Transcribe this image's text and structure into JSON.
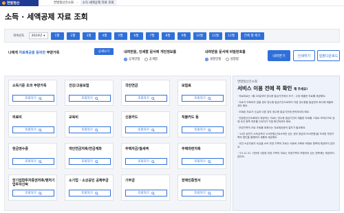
{
  "topbar": {
    "logo": "연말정산",
    "crumbs": [
      "연말정산간소화",
      "소득·세액공제 자료 조회"
    ]
  },
  "page_title": "소득 · 세액공제 자료 조회",
  "year_filter": {
    "label": "귀속년도",
    "selected_year": "2024년",
    "months": [
      "1월",
      "2월",
      "3월",
      "4월",
      "5월",
      "6월",
      "7월",
      "8월",
      "9월",
      "10월",
      "11월",
      "12월"
    ],
    "all_label": "전체 월 체크"
  },
  "filter": {
    "consent_pre": "나에게 ",
    "consent_hl": "자료제공을 동의한",
    "consent_post": " 부양가족",
    "detail_button": "상세보기",
    "privacy": {
      "label": "내려받을, 인쇄할 문서에 개인정보를",
      "options": [
        "공개안함",
        "공개함"
      ],
      "selected": 0
    },
    "password": {
      "label": "내려받을 문서에 비밀번호를",
      "options": [
        "설정안함",
        "설정함"
      ],
      "selected": 0
    }
  },
  "actions": {
    "download": "내려받기",
    "print": "인쇄하기",
    "simplified": "일괄다운로드"
  },
  "cards": [
    {
      "title": "소득기준 초과 부양가족",
      "button": "조회하기"
    },
    {
      "title": "건강/고용보험",
      "button": "조회하기"
    },
    {
      "title": "국민연금",
      "button": "조회하기"
    },
    {
      "title": "보험료",
      "button": "조회하기"
    },
    {
      "title": "의료비",
      "button": "조회하기"
    },
    {
      "title": "교육비",
      "button": "조회하기"
    },
    {
      "title": "신용카드",
      "button": "조회하기"
    },
    {
      "title": "직불카드 등",
      "button": "조회하기"
    },
    {
      "title": "현금영수증",
      "button": "조회하기"
    },
    {
      "title": "개인연금저축/연금계좌",
      "button": "조회하기"
    },
    {
      "title": "주택자금/월세액",
      "button": "조회하기"
    },
    {
      "title": "주택마련저축",
      "button": "조회하기"
    },
    {
      "title": "장기집합투자증권저축/벤처기업투자신탁",
      "button": "조회하기"
    },
    {
      "title": "소기업 · 소상공인 공제부금",
      "button": "조회하기"
    },
    {
      "title": "기부금",
      "button": "조회하기"
    },
    {
      "title": "장애인증명서",
      "button": "조회하기"
    }
  ],
  "notice": {
    "sub": "연말정산간소화",
    "title": "서비스 이용 전에 꼭 확인",
    "title_suffix": "해 주세요!",
    "items": [
      "· 의료비료는 1월 20일부터 영수증 발급기관에서 추가 · 수정 제출한 자료를 제공해요.",
      "· 자료가 조회되지 않을 경우 영수증 발급기관으로부터 직접 영수증을 발급받아 회사에 제출하셔야 돼요.",
      "· 조회된 자료가 사실과 다른 경우 영수증 발급기관에 문의하셔야 해요.",
      "· 연말정산간소화에서 제공하는 자료는 영수증 발급기관이 제출한 자료를 그대로 보여주므로 공제 요건 충족 여부를 근로자가 직접 확인하셔야 돼요.",
      "· 부양가족의 자료 조회를 위해서는 자료제공동의 절차가 필요해요.",
      "· '24년 상반기 소득금액이 100만원(근로소득만 있는 경우 총급여 500만원)을 초과한 부양가족의 명단을 올해부터 새롭게 제공해요",
      "· 국민 소유자동차 요금을 소득 부양 가족의 자료는 의료비·교육비·보험료 항목에 제공하지 않아요.",
      "· '23.12.31. 이전에 사망한 부양 가족의 자료는 부양가족이 포함되어 있는 명목에는 제공하지 않아요."
    ]
  },
  "colors": {
    "primary": "#2f6fd9",
    "brand": "#1f3a93",
    "panel_bg": "#f4f5f8",
    "notice_bg": "#eef2fb"
  },
  "icons": {
    "card_button": "search-icon",
    "year_select": "chevron-down-icon"
  }
}
